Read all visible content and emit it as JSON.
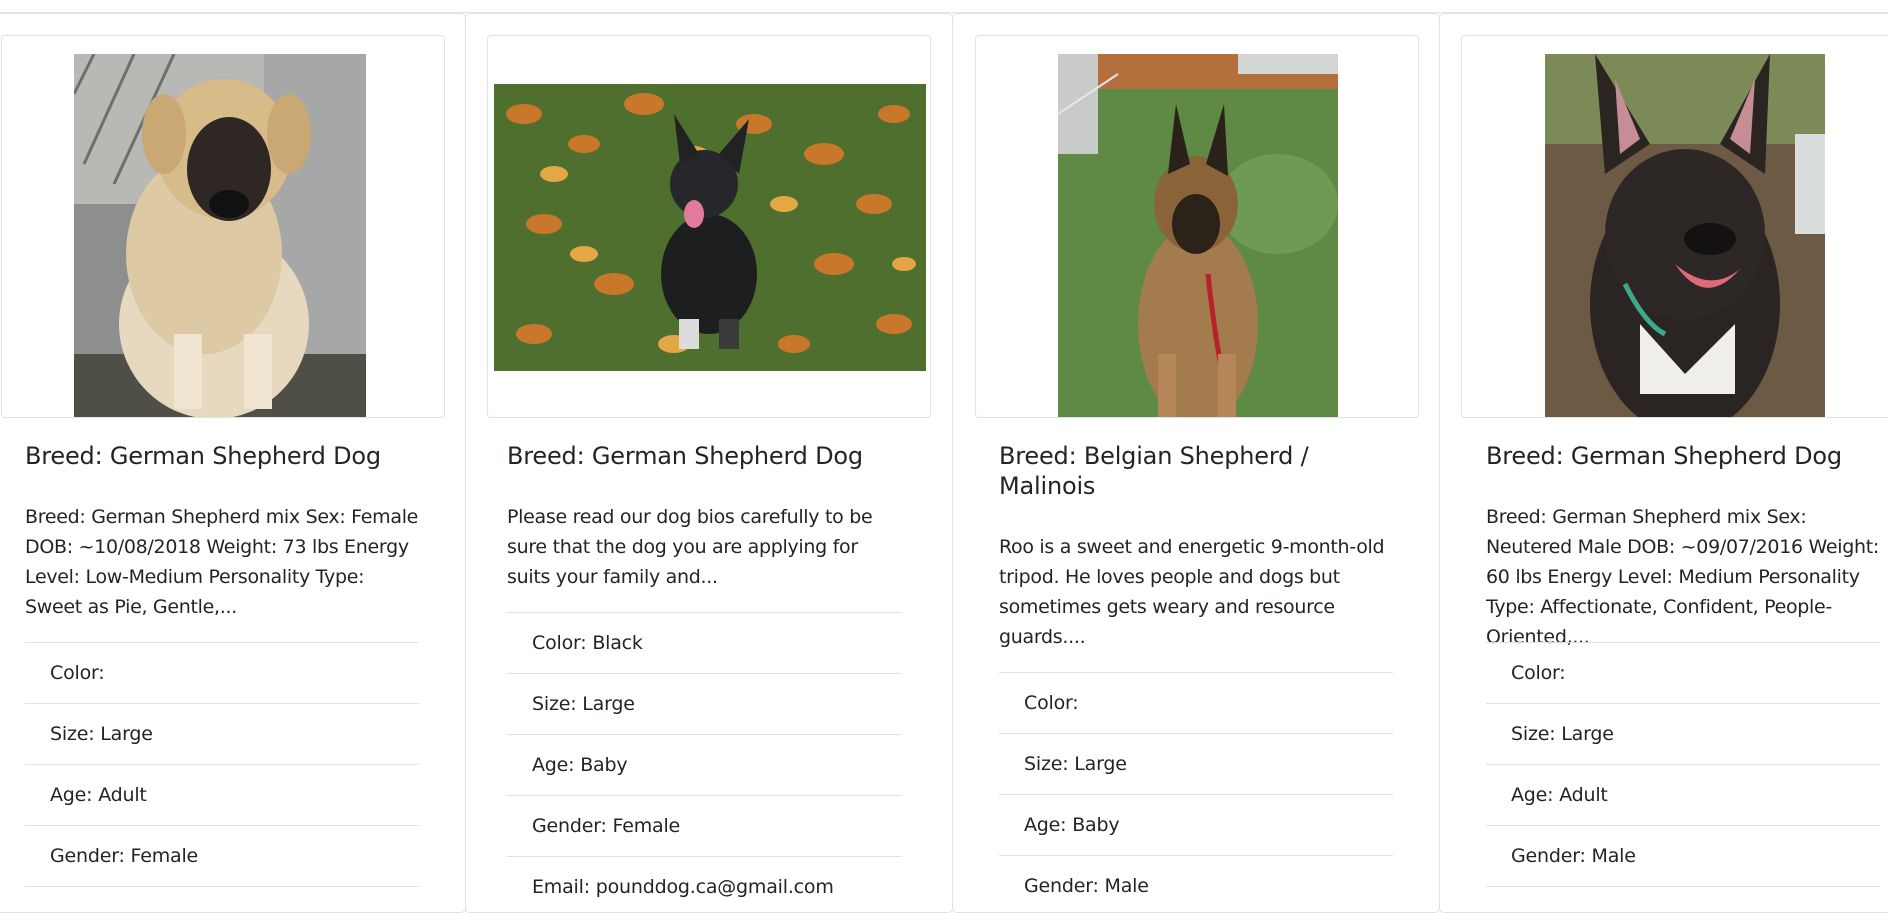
{
  "cards": [
    {
      "title": "Breed: German Shepherd Dog",
      "description": "Breed: German Shepherd mix Sex: Female DOB: ~10/08/2018 Weight: 73 lbs Energy Level: Low-Medium Personality Type: Sweet as Pie, Gentle,...",
      "photo_alt": "tan-and-black-dog-sitting-in-kennel",
      "details": [
        "Color:",
        "Size: Large",
        "Age: Adult",
        "Gender: Female"
      ]
    },
    {
      "title": "Breed: German Shepherd Dog",
      "description": "Please read our dog bios carefully to be sure that the dog you are applying for suits your family and...",
      "photo_alt": "black-puppy-sitting-in-autumn-leaves",
      "details": [
        "Color: Black",
        "Size: Large",
        "Age: Baby",
        "Gender: Female",
        "Email: pounddog.ca@gmail.com"
      ]
    },
    {
      "title": "Breed: Belgian Shepherd / Malinois",
      "description": "Roo is a sweet and energetic 9-month-old tripod. He loves people and dogs but sometimes gets weary and resource guards....",
      "photo_alt": "malinois-sitting-on-artificial-grass",
      "details": [
        "Color:",
        "Size: Large",
        "Age: Baby",
        "Gender: Male"
      ]
    },
    {
      "title": "Breed: German Shepherd Dog",
      "description": "Breed: German Shepherd mix Sex: Neutered Male DOB: ~09/07/2016 Weight: 60 lbs Energy Level: Medium Personality Type: Affectionate, Confident, People-Oriented,...",
      "photo_alt": "brindle-dog-smiling-close-up",
      "details": [
        "Color:",
        "Size: Large",
        "Age: Adult",
        "Gender: Male"
      ]
    }
  ],
  "colors": {
    "text": "#212529",
    "border": "#dfe1e4",
    "background": "#ffffff"
  }
}
